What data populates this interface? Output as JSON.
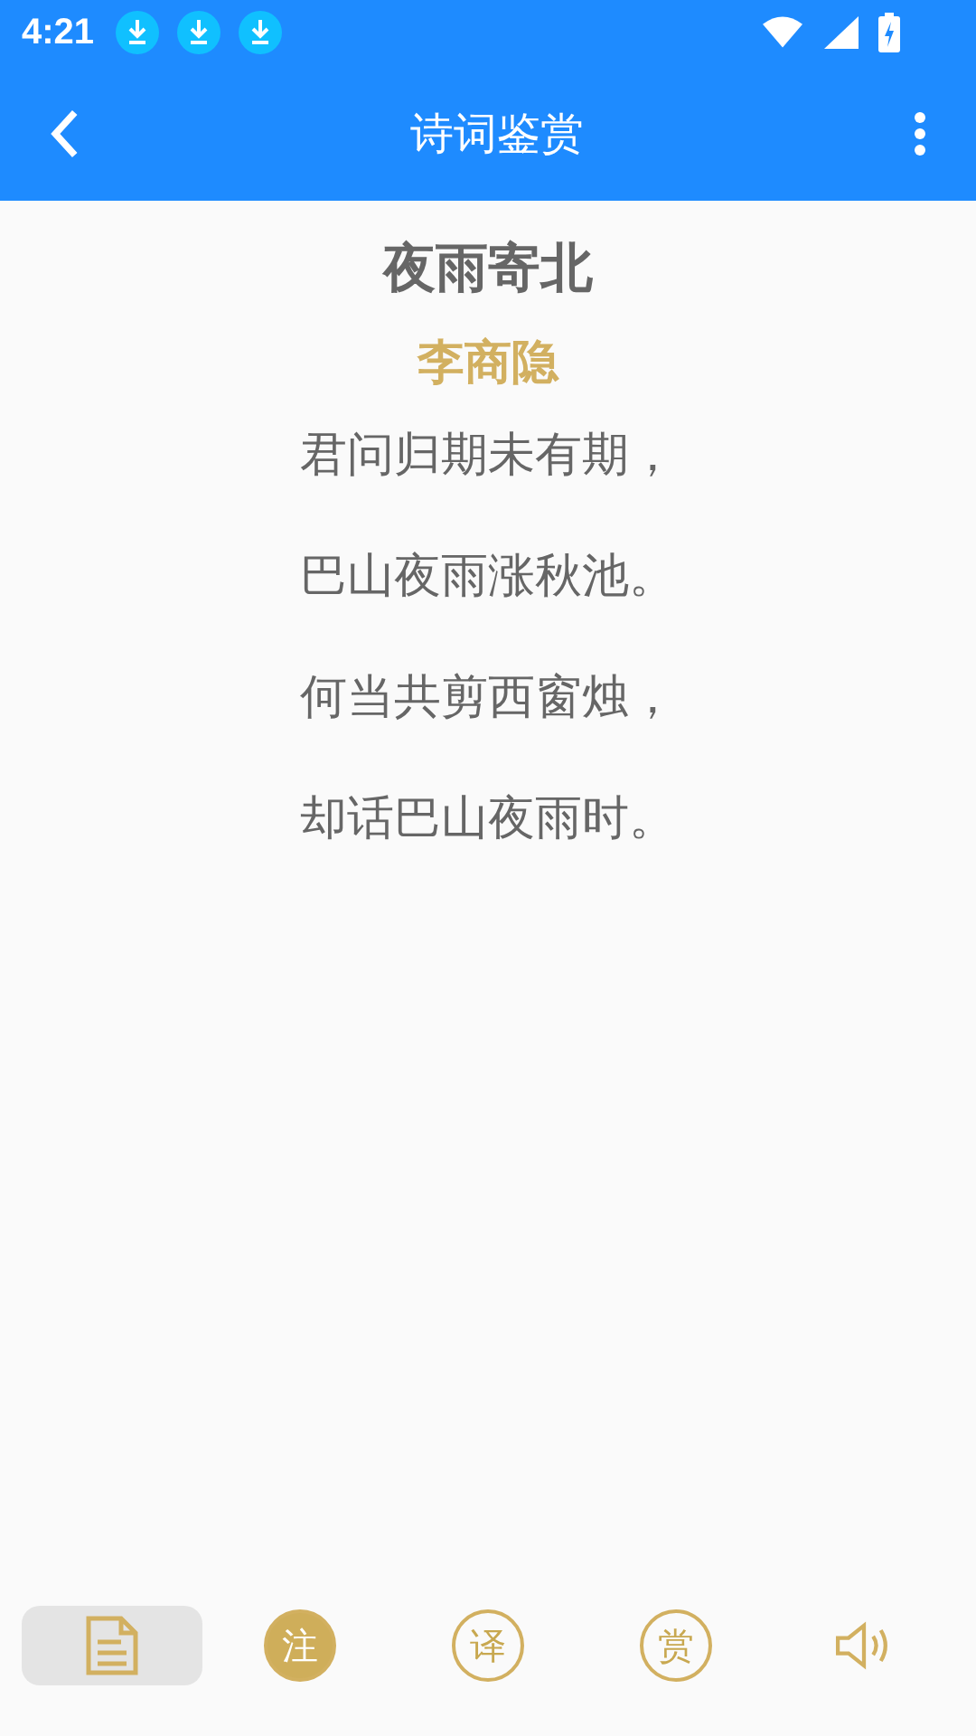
{
  "status_bar": {
    "time": "4:21",
    "notifications": [
      {
        "kind": "download"
      },
      {
        "kind": "download"
      },
      {
        "kind": "download"
      }
    ]
  },
  "app_bar": {
    "title": "诗词鉴赏"
  },
  "poem": {
    "title": "夜雨寄北",
    "author": "李商隐",
    "lines": [
      "君问归期未有期，",
      "巴山夜雨涨秋池。",
      "何当共剪西窗烛，",
      "却话巴山夜雨时。"
    ]
  },
  "toolbar": [
    {
      "kind": "document",
      "selected": true
    },
    {
      "kind": "char",
      "label": "注",
      "on": true,
      "selected": false
    },
    {
      "kind": "char",
      "label": "译",
      "on": false,
      "selected": false
    },
    {
      "kind": "char",
      "label": "赏",
      "on": false,
      "selected": false
    },
    {
      "kind": "sound",
      "selected": false
    }
  ]
}
